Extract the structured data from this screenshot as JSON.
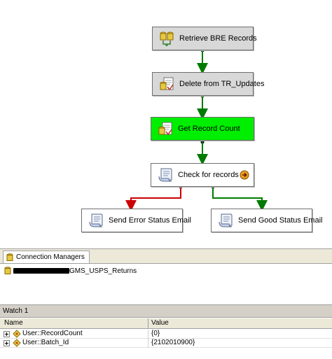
{
  "designer": {
    "tasks": [
      {
        "id": "retrieve",
        "label": "Retrieve BRE Records",
        "icon": "data-flow-icon",
        "style": "gray"
      },
      {
        "id": "delete",
        "label": "Delete from TR_Updates",
        "icon": "sql-task-icon",
        "style": "gray"
      },
      {
        "id": "count",
        "label": "Get Record Count",
        "icon": "sql-task-icon",
        "style": "green"
      },
      {
        "id": "check",
        "label": "Check for records",
        "icon": "script-task-icon",
        "style": "white"
      },
      {
        "id": "error_email",
        "label": "Send Error Status Email",
        "icon": "script-task-icon",
        "style": "white"
      },
      {
        "id": "good_email",
        "label": "Send Good Status Email",
        "icon": "script-task-icon",
        "style": "white"
      }
    ],
    "colors": {
      "success": "#007a00",
      "failure": "#cc0000",
      "executing": "#00ee00",
      "task_default": "#d8d8d8"
    }
  },
  "connection_managers": {
    "tab_label": "Connection Managers",
    "item_suffix": "GMS_USPS_Returns"
  },
  "watch": {
    "title": "Watch 1",
    "columns": {
      "name": "Name",
      "value": "Value"
    },
    "rows": [
      {
        "name": "User::RecordCount",
        "value": "{0}"
      },
      {
        "name": "User::Batch_Id",
        "value": "{2102010900}"
      }
    ]
  }
}
